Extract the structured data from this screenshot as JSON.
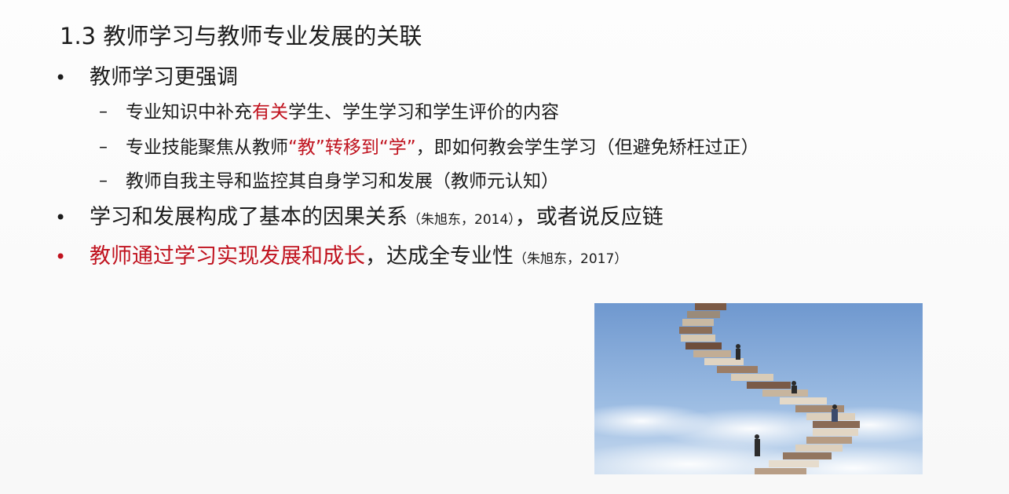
{
  "slide": {
    "title": "1.3 教师学习与教师专业发展的关联",
    "bullet_symbol": "•",
    "dash_symbol": "–",
    "b1": {
      "text": "教师学习更强调"
    },
    "s1": {
      "pre": "专业知识中补充",
      "red": "有关",
      "post": "学生、学生学习和学生评价的内容"
    },
    "s2": {
      "pre": "专业技能聚焦从教师",
      "red1": "“教”转移到“学”",
      "post": "，即如何教会学生学习（但避免矫枉过正）"
    },
    "s3": {
      "text": "教师自我主导和监控其自身学习和发展（教师元认知）"
    },
    "b2": {
      "pre": "学习和发展构成了基本的因果关系",
      "cite": "（朱旭东，2014）",
      "post": "，或者说反应链"
    },
    "b3": {
      "red": "教师通过学习实现发展和成长",
      "post": "，达成全专业性",
      "cite": "（朱旭东，2017）"
    },
    "colors": {
      "text": "#1c1c1c",
      "accent_red": "#c0121e",
      "sky": "#7fa6d8"
    }
  }
}
